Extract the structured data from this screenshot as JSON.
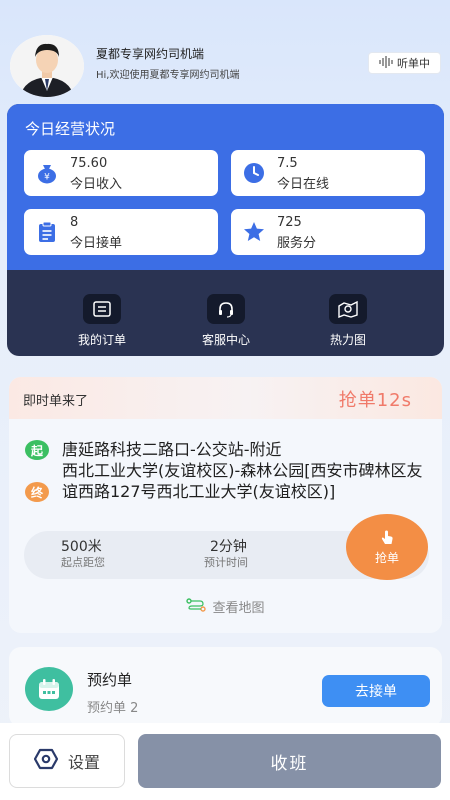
{
  "header": {
    "title": "夏都专享网约司机端",
    "subtitle": "Hi,欢迎使用夏都专享网约司机端",
    "listen_label": "听单中"
  },
  "operations": {
    "title": "今日经营状况",
    "stats": [
      {
        "value": "75.60",
        "label": "今日收入",
        "icon": "money-bag-icon"
      },
      {
        "value": "7.5",
        "label": "今日在线",
        "icon": "clock-icon"
      },
      {
        "value": "8",
        "label": "今日接单",
        "icon": "clipboard-icon"
      },
      {
        "value": "725",
        "label": "服务分",
        "icon": "star-icon"
      }
    ],
    "actions": [
      {
        "label": "我的订单",
        "icon": "orders-icon"
      },
      {
        "label": "客服中心",
        "icon": "headset-icon"
      },
      {
        "label": "热力图",
        "icon": "heatmap-icon"
      }
    ]
  },
  "instant_order": {
    "title": "即时单来了",
    "countdown": "抢单12s",
    "start_tag": "起",
    "end_tag": "终",
    "start_address": "唐延路科技二路口-公交站-附近",
    "end_address": "西北工业大学(友谊校区)-森林公园[西安市碑林区友谊西路127号西北工业大学(友谊校区)]",
    "distance_value": "500米",
    "distance_label": "起点距您",
    "time_value": "2分钟",
    "time_label": "预计时间",
    "grab_label": "抢单",
    "map_link": "查看地图"
  },
  "reservation": {
    "title": "预约单",
    "count_text": "预约单 2",
    "button_label": "去接单"
  },
  "bottom": {
    "settings_label": "设置",
    "offduty_label": "收班"
  },
  "colors": {
    "primary_blue": "#3c6ee5",
    "dark_panel": "#2a3352",
    "grab_orange": "#f38e45",
    "start_green": "#3bbf62",
    "end_orange": "#f39a4c",
    "countdown_red": "#f07a6a",
    "offduty_gray": "#8691a7"
  }
}
